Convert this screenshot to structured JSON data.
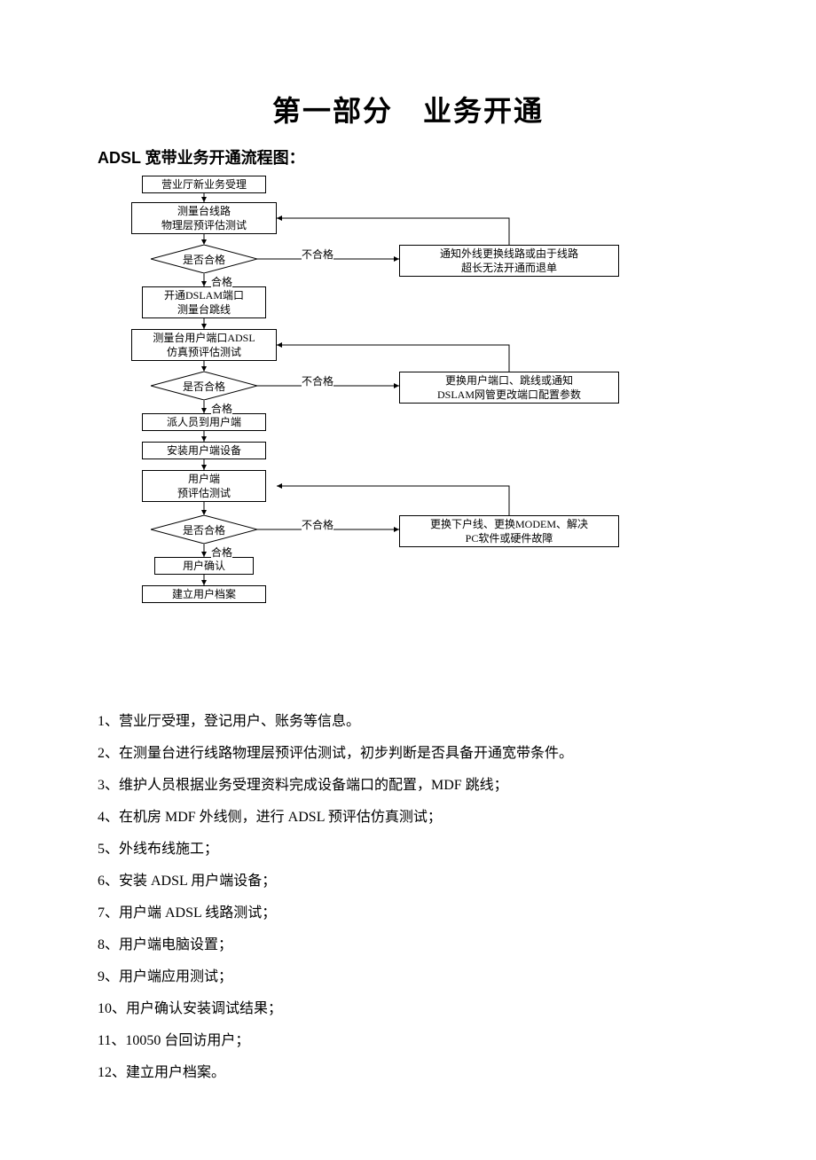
{
  "title": "第一部分　业务开通",
  "subtitle": "ADSL 宽带业务开通流程图：",
  "flow": {
    "n1": "营业厅新业务受理",
    "n2": "测量台线路\n物理层预评估测试",
    "d1": "是否合格",
    "n3": "开通DSLAM端口\n测量台跳线",
    "n4": "测量台用户端口ADSL\n仿真预评估测试",
    "d2": "是否合格",
    "n5": "派人员到用户端",
    "n6": "安装用户端设备",
    "n7": "用户端\n预评估测试",
    "d3": "是否合格",
    "n8": "用户确认",
    "n9": "建立用户档案",
    "r1": "通知外线更换线路或由于线路\n超长无法开通而退单",
    "r2": "更换用户端口、跳线或通知\nDSLAM网管更改端口配置参数",
    "r3": "更换下户线、更换MODEM、解决\nPC软件或硬件故障",
    "pass": "合格",
    "fail": "不合格"
  },
  "steps": [
    "1、营业厅受理，登记用户、账务等信息。",
    "2、在测量台进行线路物理层预评估测试，初步判断是否具备开通宽带条件。",
    "3、维护人员根据业务受理资料完成设备端口的配置，MDF 跳线；",
    "4、在机房 MDF 外线侧，进行 ADSL 预评估仿真测试；",
    "5、外线布线施工；",
    "6、安装 ADSL 用户端设备；",
    "7、用户端 ADSL 线路测试；",
    "8、用户端电脑设置；",
    "9、用户端应用测试；",
    "10、用户确认安装调试结果；",
    "11、10050 台回访用户；",
    "12、建立用户档案。"
  ]
}
